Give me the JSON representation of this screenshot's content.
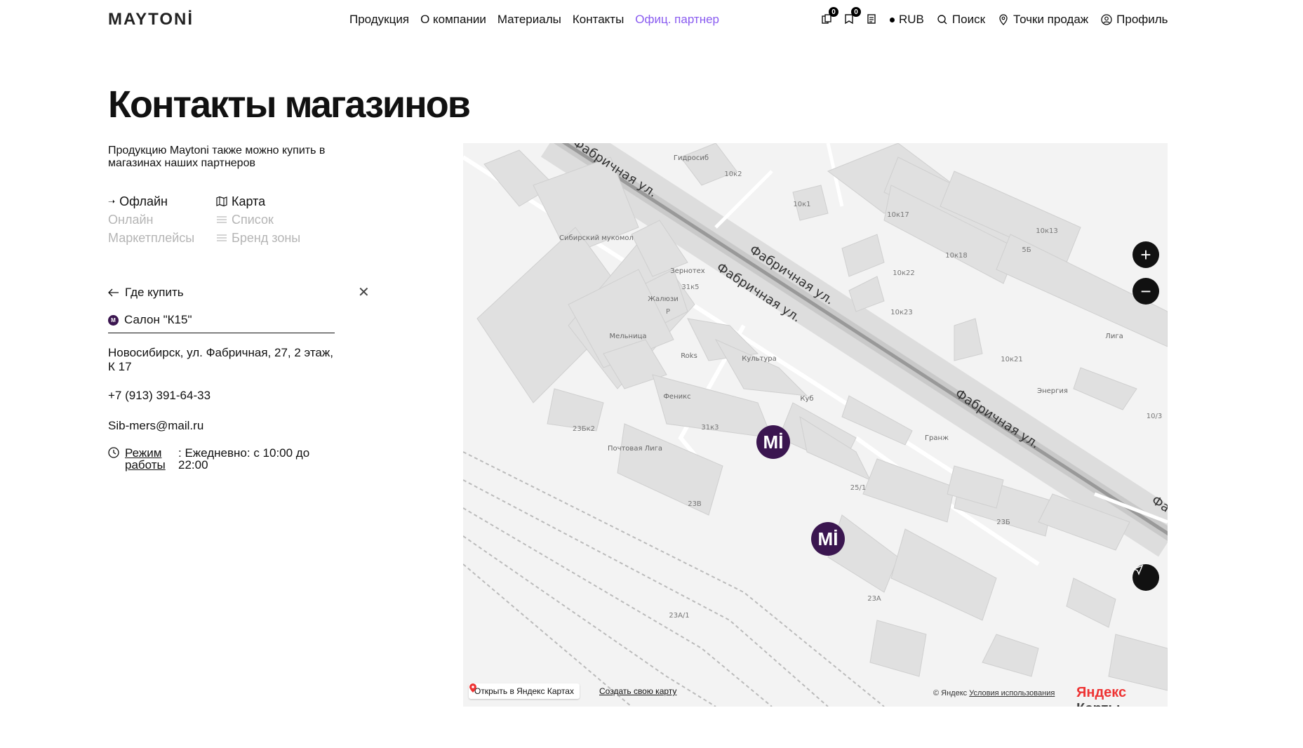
{
  "header": {
    "logo": "MAYTONİ",
    "nav": [
      "Продукция",
      "О компании",
      "Материалы",
      "Контакты",
      "Офиц. партнер"
    ],
    "compare_count": "0",
    "favorites_count": "0",
    "currency": "RUB",
    "search": "Поиск",
    "points": "Точки продаж",
    "profile": "Профиль"
  },
  "page": {
    "title": "Контакты магазинов",
    "subtitle": "Продукцию Maytoni также можно купить в магазинах наших партнеров",
    "tabs_type": [
      "Офлайн",
      "Онлайн",
      "Маркетплейсы"
    ],
    "tabs_view": [
      "Карта",
      "Список",
      "Бренд зоны"
    ],
    "back": "Где купить"
  },
  "store": {
    "name": "Салон \"К15\"",
    "address": "Новосибирск, ул. Фабричная, 27, 2 этаж, К 17",
    "phone": "+7 (913) 391-64-33",
    "email": "Sib-mers@mail.ru",
    "hours_label": "Режим работы",
    "hours_value": ": Ежедневно: с 10:00 до 22:00"
  },
  "map": {
    "street_labels": [
      "Фабричная ул.",
      "Фабричная ул.",
      "Фабричная ул.",
      "Фабричная ул.",
      "Фа"
    ],
    "poi": [
      "Гидросиб",
      "Сибирский мукомол",
      "Зернотех",
      "Жалюзи",
      "Мельница",
      "Roks",
      "Феникс",
      "Культура",
      "Куб",
      "Гранж",
      "Лига",
      "Энергия",
      "Почтовая Лига"
    ],
    "buildings": [
      "10к2",
      "10к1",
      "10к17",
      "10к13",
      "10к18",
      "10к22",
      "10к23",
      "10к21",
      "31к5",
      "31к3",
      "23Бк2",
      "23В",
      "25/1",
      "23Б",
      "23А",
      "23А/1",
      "10/3",
      "5Б",
      "Р"
    ],
    "marker_label": "Mİ",
    "open_in_yandex": "Открыть в Яндекс Картах",
    "create_map": "Создать свою карту",
    "copyright": "© Яндекс",
    "terms": "Условия использования",
    "logo_a": "Яндекс",
    "logo_b": "Карты"
  }
}
